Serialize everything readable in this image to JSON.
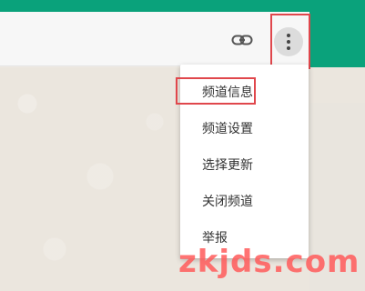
{
  "header": {
    "link_icon": "link-icon",
    "more_icon": "more-vertical-icon"
  },
  "menu": {
    "items": [
      {
        "label": "频道信息"
      },
      {
        "label": "频道设置"
      },
      {
        "label": "选择更新"
      },
      {
        "label": "关闭频道"
      },
      {
        "label": "举报"
      }
    ]
  },
  "watermark": {
    "text": "zkjds.com"
  },
  "colors": {
    "teal": "#0aa27b",
    "highlight_red": "#e0474c",
    "header_bg": "#f7f7f7",
    "chat_bg": "#ebe6de",
    "watermark": "#ff5a5a"
  }
}
